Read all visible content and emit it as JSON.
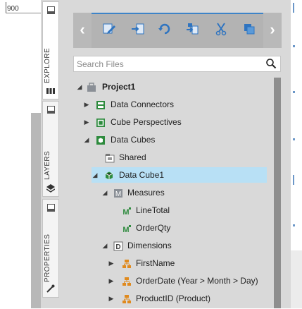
{
  "canvas": {
    "ruler_value": "900"
  },
  "tabs": [
    {
      "label": "EXPLORE"
    },
    {
      "label": "LAYERS"
    },
    {
      "label": "PROPERTIES"
    }
  ],
  "toolbar": {
    "buttons": [
      "edit-icon",
      "import-icon",
      "refresh-icon",
      "move-icon",
      "cut-icon",
      "stack-icon"
    ]
  },
  "search": {
    "placeholder": "Search Files",
    "value": ""
  },
  "tree": [
    {
      "label": "Project1",
      "icon": "project-icon",
      "expander": "expanded",
      "bold": true
    },
    {
      "label": "Data Connectors",
      "icon": "data-connectors-icon",
      "expander": "collapsed"
    },
    {
      "label": "Cube Perspectives",
      "icon": "cube-perspectives-icon",
      "expander": "collapsed"
    },
    {
      "label": "Data Cubes",
      "icon": "data-cubes-icon",
      "expander": "expanded"
    },
    {
      "label": "Shared",
      "icon": "shared-folder-icon",
      "expander": "none"
    },
    {
      "label": "Data Cube1",
      "icon": "data-cube-icon",
      "expander": "expanded",
      "selected": true
    },
    {
      "label": "Measures",
      "icon": "measures-icon",
      "expander": "expanded"
    },
    {
      "label": "LineTotal",
      "icon": "measure-icon",
      "expander": "none"
    },
    {
      "label": "OrderQty",
      "icon": "measure-icon",
      "expander": "none"
    },
    {
      "label": "Dimensions",
      "icon": "dimensions-icon",
      "expander": "expanded"
    },
    {
      "label": "FirstName",
      "icon": "hierarchy-icon",
      "expander": "collapsed"
    },
    {
      "label": "OrderDate (Year > Month > Day)",
      "icon": "hierarchy-icon",
      "expander": "collapsed"
    },
    {
      "label": "ProductID (Product)",
      "icon": "hierarchy-icon",
      "expander": "collapsed"
    }
  ],
  "colors": {
    "accent": "#3e84c8",
    "selection": "#b8e0f5",
    "panel": "#d9d9d9",
    "icon_green": "#2e8b3e",
    "icon_orange": "#e08a1e"
  }
}
